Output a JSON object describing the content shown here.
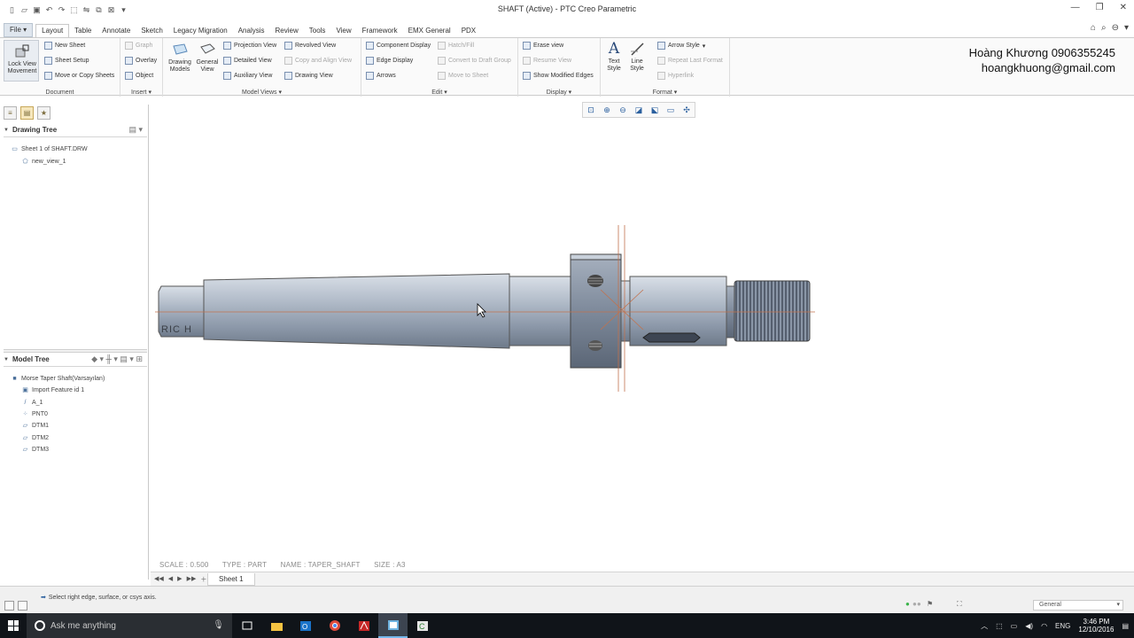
{
  "window": {
    "title": "SHAFT (Active) - PTC Creo Parametric"
  },
  "tabs": [
    "File",
    "Layout",
    "Table",
    "Annotate",
    "Sketch",
    "Legacy Migration",
    "Analysis",
    "Review",
    "Tools",
    "View",
    "Framework",
    "EMX General",
    "PDX"
  ],
  "ribbon": {
    "document": {
      "label": "Document",
      "lock_view": "Lock View Movement",
      "new_sheet": "New Sheet",
      "sheet_setup": "Sheet Setup",
      "move_copy": "Move or Copy Sheets"
    },
    "insert": {
      "label": "Insert",
      "graph": "Graph",
      "overlay": "Overlay",
      "object": "Object"
    },
    "model_views": {
      "label": "Model Views",
      "drawing_models": "Drawing Models",
      "general_view": "General View",
      "projection_view": "Projection View",
      "detailed_view": "Detailed View",
      "auxiliary_view": "Auxiliary View",
      "revolved_view": "Revolved View",
      "copy_align": "Copy and Align View",
      "drawing_view": "Drawing View"
    },
    "edit": {
      "label": "Edit",
      "component_display": "Component Display",
      "edge_display": "Edge Display",
      "arrows": "Arrows",
      "hatch_fill": "Hatch/Fill",
      "convert_draft": "Convert to Draft Group",
      "move_to_sheet": "Move to Sheet"
    },
    "display": {
      "label": "Display",
      "erase_view": "Erase view",
      "resume_view": "Resume View",
      "show_modified": "Show Modified Edges"
    },
    "format": {
      "label": "Format",
      "text_style": "Text Style",
      "line_style": "Line Style",
      "arrow_style": "Arrow Style",
      "repeat_last": "Repeat Last Format",
      "hyperlink": "Hyperlink"
    }
  },
  "overlay_text": {
    "name": "Hoàng Khương 0906355245",
    "email": "hoangkhuong@gmail.com"
  },
  "drawing_tree": {
    "title": "Drawing Tree",
    "items": [
      "Sheet 1 of SHAFT.DRW",
      "new_view_1"
    ]
  },
  "model_tree": {
    "title": "Model Tree",
    "items": [
      "Morse Taper Shaft(Varsayılan)",
      "Import Feature id 1",
      "A_1",
      "PNT0",
      "DTM1",
      "DTM2",
      "DTM3"
    ]
  },
  "status": {
    "scale": "SCALE : 0.500",
    "type": "TYPE : PART",
    "name": "NAME : TAPER_SHAFT",
    "size": "SIZE : A3"
  },
  "sheet": {
    "tab": "Sheet 1"
  },
  "message": "Select right edge, surface, or csys axis.",
  "filter": "General",
  "shaft_engraving": "RIC H",
  "taskbar": {
    "search_placeholder": "Ask me anything",
    "lang": "ENG",
    "time": "3:46 PM",
    "date": "12/10/2016"
  },
  "colors": {
    "accent": "#2a5f9e",
    "taskbar": "#101419",
    "shaft_mid": "#a9b4c2"
  }
}
